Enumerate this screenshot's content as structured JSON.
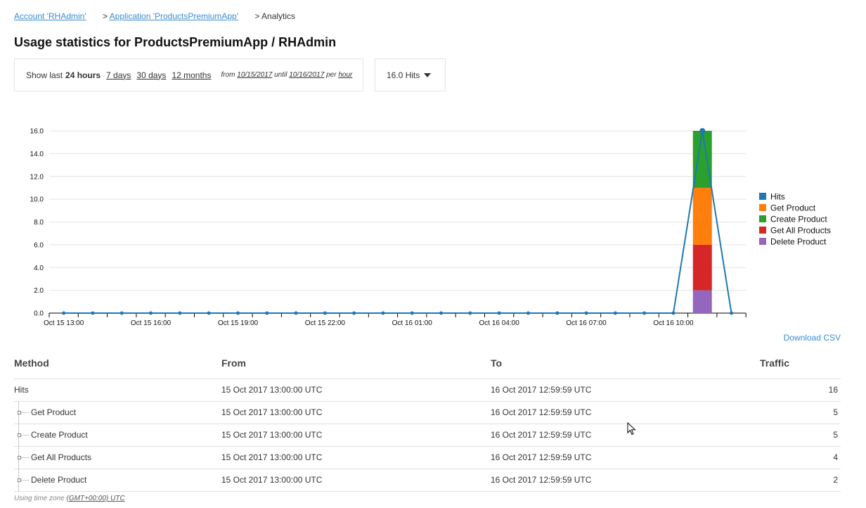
{
  "breadcrumb": {
    "account": "Account 'RHAdmin'",
    "application_prefix": ">",
    "application": "Application 'ProductsPremiumApp'",
    "current": "> Analytics"
  },
  "title": "Usage statistics for ProductsPremiumApp / RHAdmin",
  "range": {
    "show_last": "Show last",
    "current": "24 hours",
    "options": [
      "7 days",
      "30 days",
      "12 months"
    ],
    "from_label": "from",
    "from": "10/15/2017",
    "until_label": "until",
    "until": "10/16/2017",
    "per_label": "per",
    "per": "hour"
  },
  "metric_selector": {
    "value": "16.0 Hits",
    "icon": "caret-down-icon"
  },
  "chart_data": {
    "type": "bar",
    "x_ticks": [
      "Oct 15 13:00",
      "Oct 15 16:00",
      "Oct 15 19:00",
      "Oct 15 22:00",
      "Oct 16 01:00",
      "Oct 16 04:00",
      "Oct 16 07:00",
      "Oct 16 10:00"
    ],
    "y_ticks": [
      "0.0",
      "2.0",
      "4.0",
      "6.0",
      "8.0",
      "10.0",
      "12.0",
      "14.0",
      "16.0"
    ],
    "ylim": [
      0,
      16
    ],
    "grid": true,
    "legend_position": "right",
    "x_hours": 24,
    "hits_line": {
      "name": "Hits",
      "color": "#1f77b4",
      "values": [
        0,
        0,
        0,
        0,
        0,
        0,
        0,
        0,
        0,
        0,
        0,
        0,
        0,
        0,
        0,
        0,
        0,
        0,
        0,
        0,
        0,
        0,
        16,
        0
      ]
    },
    "stack_index": 22,
    "series": [
      {
        "name": "Delete Product",
        "color": "#9467bd",
        "values": [
          0,
          0,
          0,
          0,
          0,
          0,
          0,
          0,
          0,
          0,
          0,
          0,
          0,
          0,
          0,
          0,
          0,
          0,
          0,
          0,
          0,
          0,
          2,
          0
        ]
      },
      {
        "name": "Get All Products",
        "color": "#d62728",
        "values": [
          0,
          0,
          0,
          0,
          0,
          0,
          0,
          0,
          0,
          0,
          0,
          0,
          0,
          0,
          0,
          0,
          0,
          0,
          0,
          0,
          0,
          0,
          4,
          0
        ]
      },
      {
        "name": "Get Product",
        "color": "#ff7f0e",
        "values": [
          0,
          0,
          0,
          0,
          0,
          0,
          0,
          0,
          0,
          0,
          0,
          0,
          0,
          0,
          0,
          0,
          0,
          0,
          0,
          0,
          0,
          0,
          5,
          0
        ]
      },
      {
        "name": "Create Product",
        "color": "#2ca02c",
        "values": [
          0,
          0,
          0,
          0,
          0,
          0,
          0,
          0,
          0,
          0,
          0,
          0,
          0,
          0,
          0,
          0,
          0,
          0,
          0,
          0,
          0,
          0,
          5,
          0
        ]
      }
    ],
    "legend": [
      {
        "name": "Hits",
        "color": "#1f77b4"
      },
      {
        "name": "Get Product",
        "color": "#ff7f0e"
      },
      {
        "name": "Create Product",
        "color": "#2ca02c"
      },
      {
        "name": "Get All Products",
        "color": "#d62728"
      },
      {
        "name": "Delete Product",
        "color": "#9467bd"
      }
    ]
  },
  "download_csv": "Download CSV",
  "table": {
    "headers": {
      "method": "Method",
      "from": "From",
      "to": "To",
      "traffic": "Traffic"
    },
    "rows": [
      {
        "method": "Hits",
        "from": "15 Oct 2017 13:00:00 UTC",
        "to": "16 Oct 2017 12:59:59 UTC",
        "traffic": "16"
      },
      {
        "method": "Get Product",
        "from": "15 Oct 2017 13:00:00 UTC",
        "to": "16 Oct 2017 12:59:59 UTC",
        "traffic": "5"
      },
      {
        "method": "Create Product",
        "from": "15 Oct 2017 13:00:00 UTC",
        "to": "16 Oct 2017 12:59:59 UTC",
        "traffic": "5"
      },
      {
        "method": "Get All Products",
        "from": "15 Oct 2017 13:00:00 UTC",
        "to": "16 Oct 2017 12:59:59 UTC",
        "traffic": "4"
      },
      {
        "method": "Delete Product",
        "from": "15 Oct 2017 13:00:00 UTC",
        "to": "16 Oct 2017 12:59:59 UTC",
        "traffic": "2"
      }
    ]
  },
  "timezone_note": {
    "prefix": "Using time zone",
    "zone": "(GMT+00:00) UTC"
  }
}
